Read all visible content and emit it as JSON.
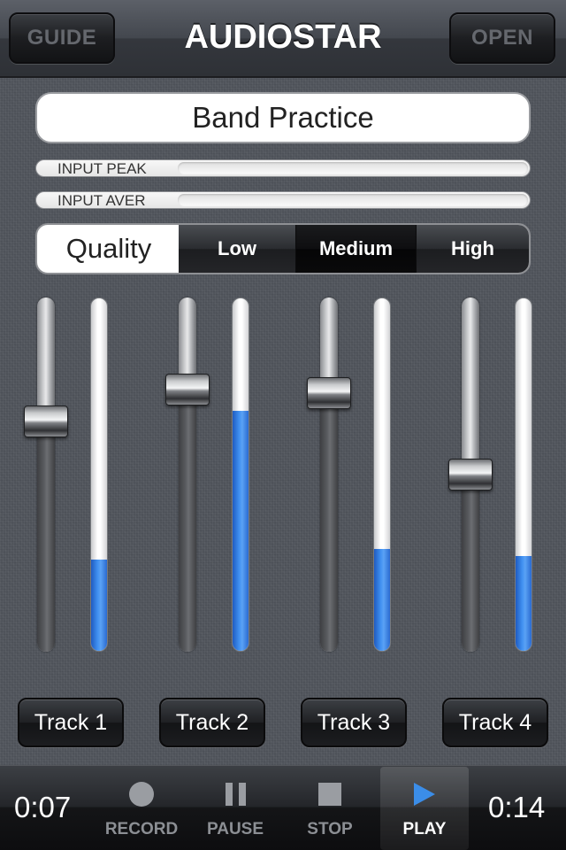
{
  "navbar": {
    "title": "AUDIOSTAR",
    "left_button": "GUIDE",
    "right_button": "OPEN"
  },
  "session": {
    "name": "Band Practice"
  },
  "meters": [
    {
      "label": "INPUT PEAK",
      "level": 0.0
    },
    {
      "label": "INPUT AVER",
      "level": 0.0
    }
  ],
  "quality": {
    "label": "Quality",
    "options": [
      "Low",
      "Medium",
      "High"
    ],
    "selected": "Medium"
  },
  "tracks": [
    {
      "name": "Track 1",
      "volume": 0.65,
      "level": 0.26
    },
    {
      "name": "Track 2",
      "volume": 0.74,
      "level": 0.68
    },
    {
      "name": "Track 3",
      "volume": 0.73,
      "level": 0.29
    },
    {
      "name": "Track 4",
      "volume": 0.5,
      "level": 0.27
    }
  ],
  "transport": {
    "elapsed": "0:07",
    "total": "0:14",
    "record_label": "RECORD",
    "pause_label": "PAUSE",
    "stop_label": "STOP",
    "play_label": "PLAY",
    "active": "PLAY"
  },
  "colors": {
    "accent": "#3b82e8",
    "background": "#51555c"
  },
  "icons": {
    "record": "record-circle-icon",
    "pause": "pause-icon",
    "stop": "stop-square-icon",
    "play": "play-triangle-icon"
  }
}
